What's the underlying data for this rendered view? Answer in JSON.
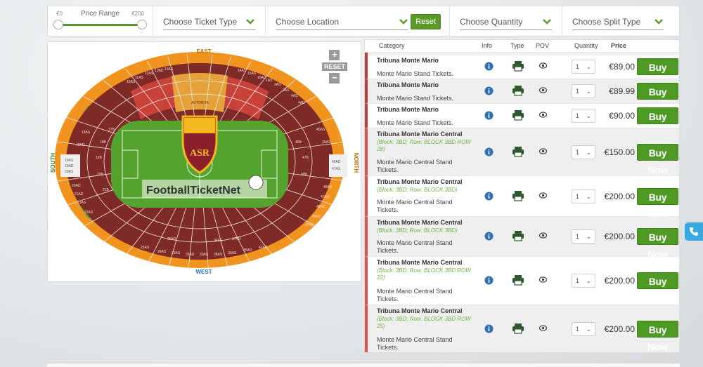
{
  "filters": {
    "price": {
      "min_label": "€0",
      "max_label": "€200",
      "label": "Price Range"
    },
    "ticket_type": "Choose Ticket Type",
    "location": "Choose Location",
    "reset_label": "Reset",
    "quantity": "Choose Quantity",
    "split_type": "Choose Split Type"
  },
  "map": {
    "reset_label": "RESET",
    "zoom_in": "+",
    "zoom_out": "−",
    "stands": {
      "east": "EAST",
      "west": "WEST",
      "north": "NORTH",
      "south": "SOUTH"
    },
    "watermark": "FootballTicketNet",
    "club_badge_text": "ASR",
    "east_sections": [
      "10AS",
      "11AS",
      "12AS",
      "13AD",
      "13AS",
      "14AS",
      "15AS",
      "15AD",
      "1AS",
      "2AS",
      "3AS",
      "4AS",
      "4AD"
    ],
    "west_sections": [
      "25AS",
      "26AS",
      "29AS",
      "33AD",
      "33AS",
      "38AS",
      "39AS",
      "35AD",
      "42AD",
      "26AD",
      "34AS",
      "37AD"
    ],
    "south_sections": [
      "18AS",
      "18AD",
      "19AS",
      "19AD",
      "20AS",
      "20AD",
      "21AD",
      "21AS",
      "22AS",
      "19B",
      "20B",
      "21B",
      "17B",
      "18B"
    ],
    "north_sections": [
      "45AS",
      "46AS",
      "47AS",
      "48AS",
      "46AD",
      "47AD",
      "48AD",
      "49AS",
      "49AD",
      "47B",
      "48B",
      "46B"
    ],
    "central_label": "AUTORITA"
  },
  "listing": {
    "headers": {
      "category": "Category",
      "info": "Info",
      "type": "Type",
      "pov": "POV",
      "quantity": "Quantity",
      "price": "Price"
    },
    "buy_label": "Buy Now",
    "qty_value": "1",
    "rows": [
      {
        "name": "Tribuna Monte Mario",
        "block": "",
        "desc": "Monte Mario Stand Tickets.",
        "price": "€89.00"
      },
      {
        "name": "Tribuna Monte Mario",
        "block": "",
        "desc": "Monte Mario Stand Tickets.",
        "price": "€89.99"
      },
      {
        "name": "Tribuna Monte Mario",
        "block": "",
        "desc": "Monte Mario Stand Tickets.",
        "price": "€90.00"
      },
      {
        "name": "Tribuna Monte Mario Central",
        "block": "(Block: 3BD; Row: BLOCK 3BD ROW 28)",
        "desc": "Monte Mario Central Stand Tickets.",
        "price": "€150.00"
      },
      {
        "name": "Tribuna Monte Mario Central",
        "block": "(Block: 3BD; Row: BLOCK 3BD)",
        "desc": "Monte Mario Central Stand Tickets.",
        "price": "€200.00"
      },
      {
        "name": "Tribuna Monte Mario Central",
        "block": "(Block: 3BD; Row: BLOCK 3BD)",
        "desc": "Monte Mario Central Stand Tickets.",
        "price": "€200.00"
      },
      {
        "name": "Tribuna Monte Mario Central",
        "block": "(Block: 3BD; Row: BLOCK 3BD ROW 22)",
        "desc": "Monte Mario Central Stand Tickets.",
        "price": "€200.00"
      },
      {
        "name": "Tribuna Monte Mario Central",
        "block": "(Block: 3BD; Row: BLOCK 3BD ROW 25)",
        "desc": "Monte Mario Central Stand Tickets.",
        "price": "€200.00"
      }
    ]
  },
  "colors": {
    "accent_green": "#4e9a25",
    "row_border": "#b9403f",
    "block_text": "#6fb545",
    "east_stand": "#f2c200",
    "west_stand": "#1e7ec8",
    "north_stand": "#f0941f",
    "south_stand": "#4ea83a",
    "sections": "#7e2a26",
    "pitch": "#55a32f"
  },
  "icons": [
    "info-icon",
    "printer-icon",
    "eye-icon",
    "chevron-down-icon",
    "phone-icon"
  ]
}
